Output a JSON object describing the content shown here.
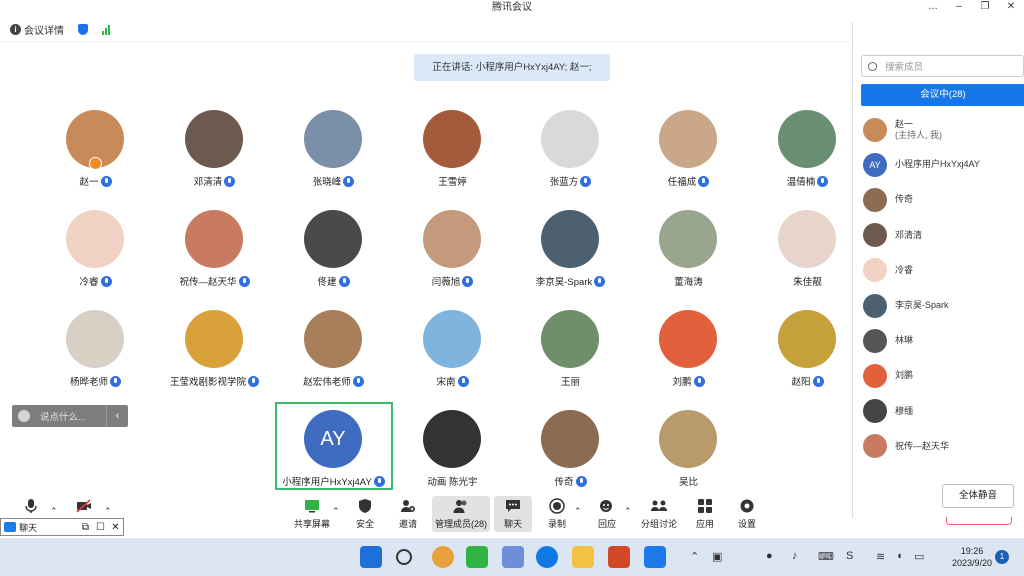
{
  "window": {
    "title": "腾讯会议",
    "controls": [
      "…",
      "–",
      "❐",
      "✕"
    ]
  },
  "infobar": {
    "meeting_details": "会议详情"
  },
  "speaking_banner": "正在讲话: 小程序用户HxYxj4AY; 赵一;",
  "participants_grid": [
    {
      "name": "赵一",
      "mic": true,
      "host": true,
      "color": "#c98a5a"
    },
    {
      "name": "邓清清",
      "mic": true,
      "color": "#6d5a4e"
    },
    {
      "name": "张晓峰",
      "mic": true,
      "color": "#7a8fa8"
    },
    {
      "name": "王雪婷",
      "mic": false,
      "color": "#a45b3c"
    },
    {
      "name": "张蓝方",
      "mic": true,
      "color": "#d9d9d9"
    },
    {
      "name": "任福成",
      "mic": true,
      "color": "#caa789"
    },
    {
      "name": "温倩楠",
      "mic": true,
      "color": "#6b8f75"
    },
    {
      "name": "冷睿",
      "mic": true,
      "color": "#f1d2c4"
    },
    {
      "name": "祝传—赵天华",
      "mic": true,
      "color": "#c97b62"
    },
    {
      "name": "佟建",
      "mic": true,
      "color": "#4a4a4a"
    },
    {
      "name": "闫薇旭",
      "mic": true,
      "color": "#c49a7c"
    },
    {
      "name": "李京昊-Spark",
      "mic": true,
      "color": "#4d6070"
    },
    {
      "name": "董海涛",
      "mic": false,
      "color": "#9aa58e"
    },
    {
      "name": "朱佳靓",
      "mic": false,
      "color": "#e7d4cb"
    },
    {
      "name": "杨晔老师",
      "mic": true,
      "color": "#d8d0c4"
    },
    {
      "name": "王莹戏剧影视学院",
      "mic": true,
      "color": "#d9a13a"
    },
    {
      "name": "赵宏伟老师",
      "mic": true,
      "color": "#a77f5b"
    },
    {
      "name": "宋南",
      "mic": true,
      "color": "#7fb4de"
    },
    {
      "name": "王丽",
      "mic": false,
      "color": "#6e8f6a"
    },
    {
      "name": "刘鹏",
      "mic": true,
      "color": "#e3603c"
    },
    {
      "name": "赵阳",
      "mic": true,
      "color": "#c6a13b"
    },
    {
      "name": "小程序用户HxYxj4AY",
      "mic": true,
      "initials": "AY",
      "color": "#3f6bc1"
    },
    {
      "name": "动画 陈光宇",
      "mic": false,
      "color": "#333333"
    },
    {
      "name": "传奇",
      "mic": true,
      "color": "#8b6b52"
    },
    {
      "name": "吴比",
      "mic": false,
      "color": "#b99a6a"
    }
  ],
  "chat_input": {
    "placeholder": "说点什么..."
  },
  "toolbar": {
    "share_screen": "共享屏幕",
    "security": "安全",
    "invite": "邀请",
    "manage_members": "管理成员(28)",
    "chat": "聊天",
    "record": "录制",
    "react": "回应",
    "breakout": "分组讨论",
    "apps": "应用",
    "settings": "设置"
  },
  "members_panel": {
    "search_placeholder": "搜索成员",
    "in_meeting_tab": "会议中(28)",
    "members": [
      {
        "name": "赵一",
        "note": "(主持人, 我)",
        "color": "#c98a5a"
      },
      {
        "name": "小程序用户HxYxj4AY",
        "initials": "AY",
        "color": "#3f6bc1"
      },
      {
        "name": "传奇",
        "color": "#8b6b52"
      },
      {
        "name": "邓清清",
        "color": "#6d5a4e"
      },
      {
        "name": "冷睿",
        "color": "#f1d2c4"
      },
      {
        "name": "李京昊-Spark",
        "color": "#4d6070"
      },
      {
        "name": "林琳",
        "color": "#555555"
      },
      {
        "name": "刘鹏",
        "color": "#e3603c"
      },
      {
        "name": "穆缅",
        "color": "#444444"
      },
      {
        "name": "祝传—赵天华",
        "color": "#c97b62"
      }
    ],
    "mute_all": "全体静音"
  },
  "mini_window": {
    "title": "聊天"
  },
  "taskbar": {
    "time": "19:26",
    "date": "2023/9/20",
    "notifications": "1"
  }
}
